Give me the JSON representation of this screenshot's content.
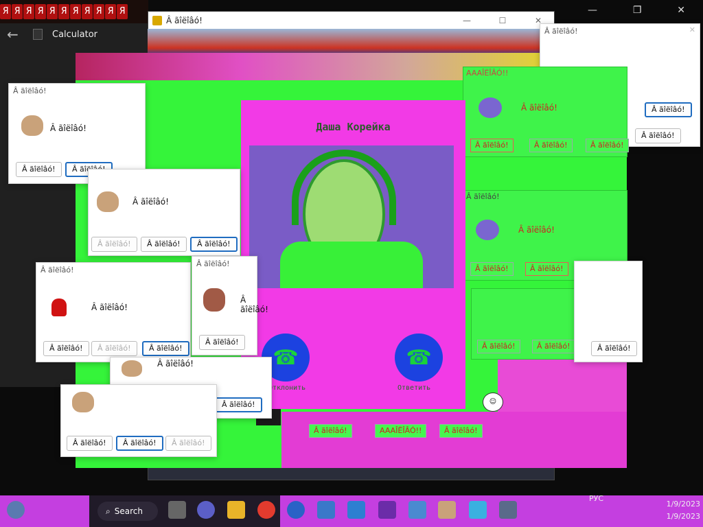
{
  "tabstrip": {
    "glyph": "Я",
    "count": 11
  },
  "calculator": {
    "title": "Calculator"
  },
  "main_window": {
    "title": "Â ãîëîâó!"
  },
  "dialog_text": "Â ãîëîâó!",
  "dialog_title": "Â ãîëîâó!",
  "glitch_title": "AAAÎËÎÂÓ!!",
  "call": {
    "name": "Даша Корейка",
    "decline_label": "Отклонить",
    "accept_label": "Ответить"
  },
  "taskbar": {
    "search_label": "Search",
    "lang": "РУС",
    "date1": "1/9/2023",
    "date2": "1/9/2023"
  },
  "colors": {
    "glitch_green": "#35f43a",
    "glitch_magenta": "#f23ae6",
    "taskbar": "#c43fe0",
    "accent_blue": "#1f6cc0"
  }
}
